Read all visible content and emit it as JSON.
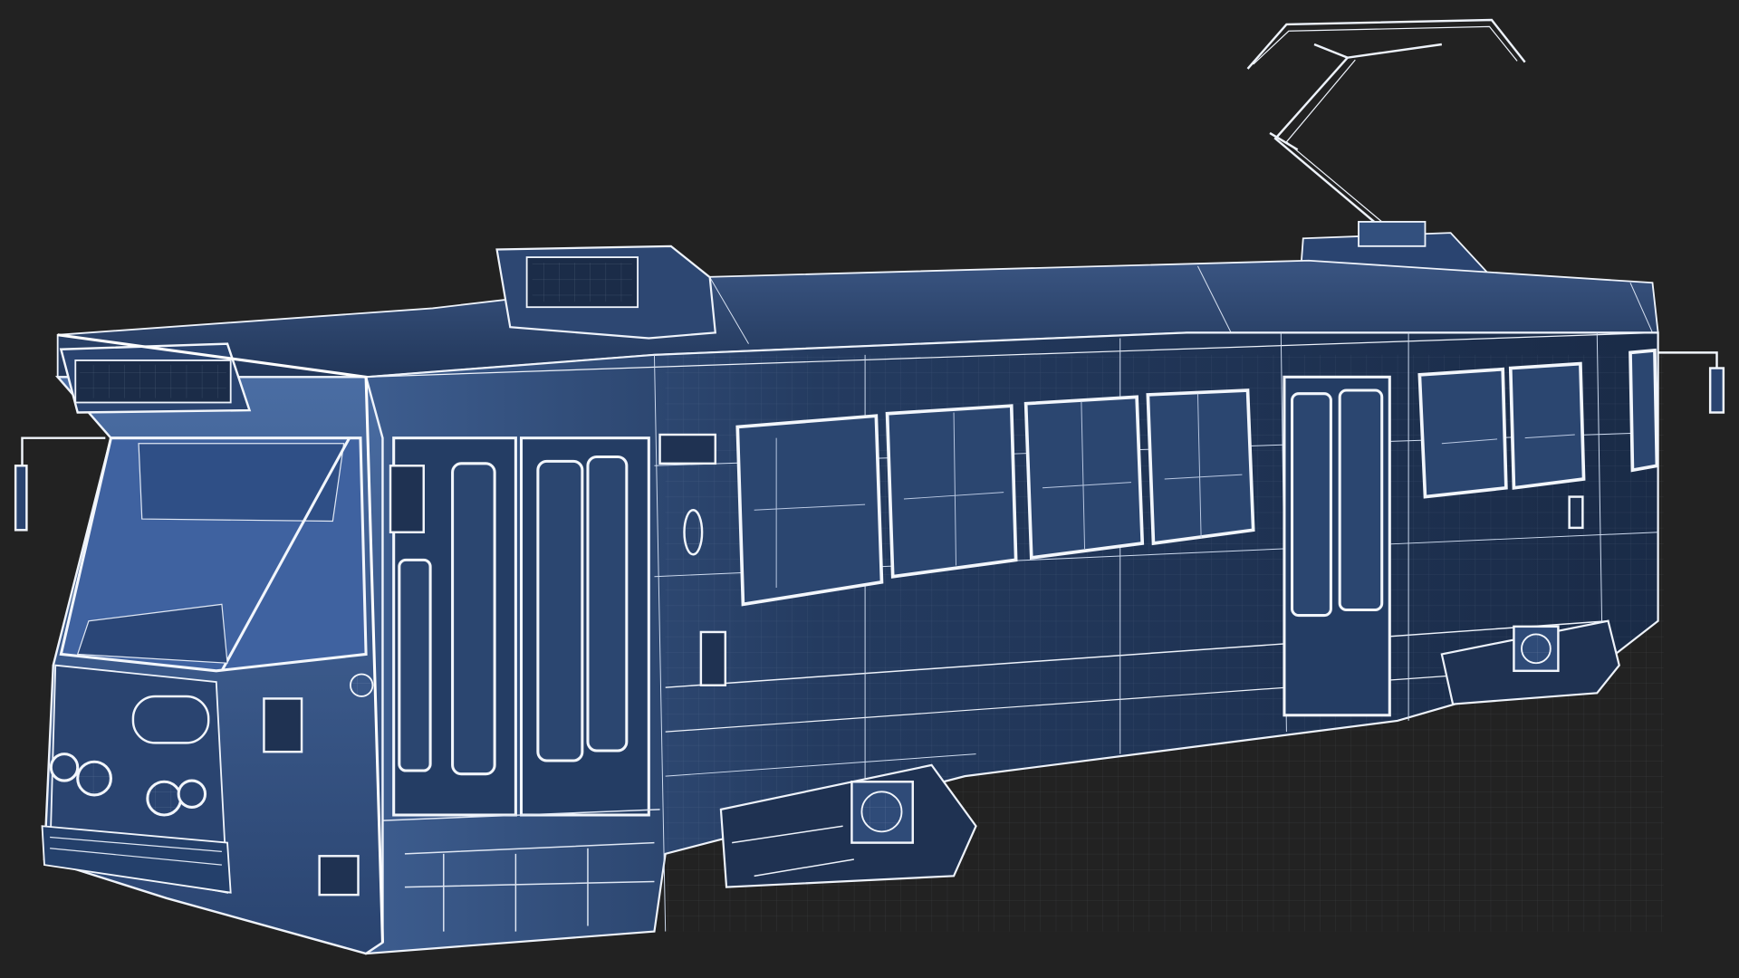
{
  "scene": {
    "subject": "tram",
    "style": "wireframe",
    "background_color": "#222222",
    "body_color": "#1f3252",
    "body_color_light": "#3a5a8c",
    "wire_color": "#e8eef8"
  }
}
